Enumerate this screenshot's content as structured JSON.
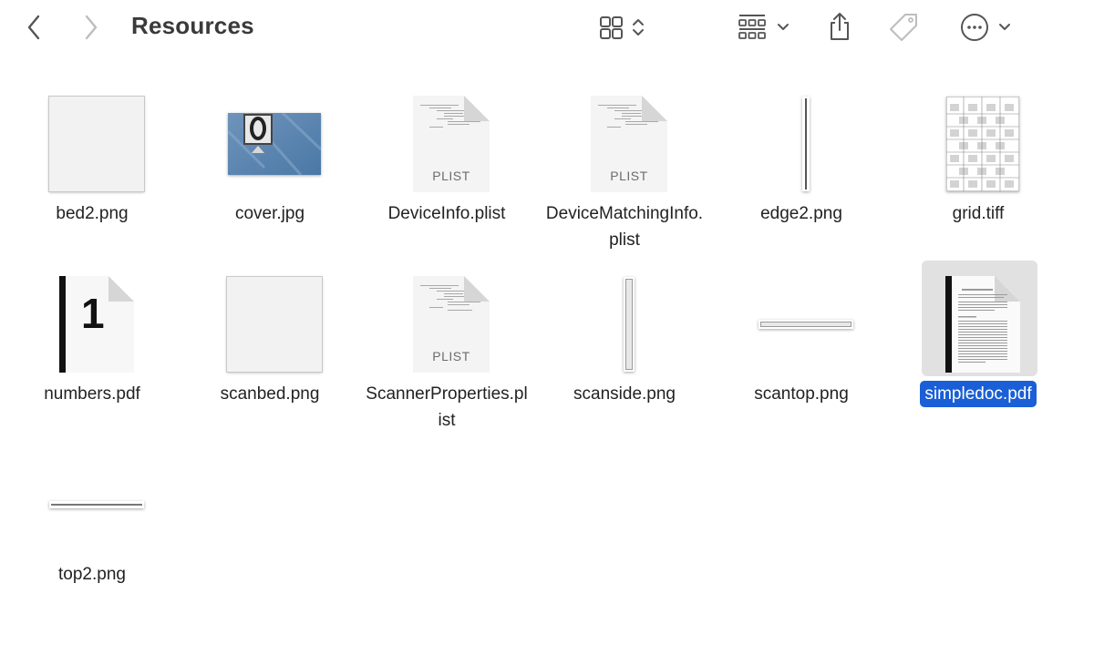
{
  "window": {
    "title": "Resources"
  },
  "toolbar": {
    "icons": [
      "back-icon",
      "forward-icon",
      "icon-view-icon",
      "group-icon",
      "share-icon",
      "tag-icon",
      "more-icon"
    ]
  },
  "files": [
    {
      "name": "bed2.png",
      "kind": "image-blank"
    },
    {
      "name": "cover.jpg",
      "kind": "image-photo"
    },
    {
      "name": "DeviceInfo.plist",
      "kind": "plist",
      "badge": "PLIST"
    },
    {
      "name": "DeviceMatchingInfo.plist",
      "kind": "plist",
      "badge": "PLIST"
    },
    {
      "name": "edge2.png",
      "kind": "image-thin-vertical"
    },
    {
      "name": "grid.tiff",
      "kind": "image-grid"
    },
    {
      "name": "numbers.pdf",
      "kind": "pdf-number",
      "glyph": "1"
    },
    {
      "name": "scanbed.png",
      "kind": "image-blank"
    },
    {
      "name": "ScannerProperties.plist",
      "kind": "plist",
      "badge": "PLIST"
    },
    {
      "name": "scanside.png",
      "kind": "image-thin-vertical"
    },
    {
      "name": "scantop.png",
      "kind": "image-thin-horizontal"
    },
    {
      "name": "simpledoc.pdf",
      "kind": "pdf-doc",
      "selected": true
    },
    {
      "name": "top2.png",
      "kind": "image-thin-horizontal"
    }
  ],
  "colors": {
    "selection": "#1a5fd6",
    "selection_bg": "#e1e1e1"
  }
}
